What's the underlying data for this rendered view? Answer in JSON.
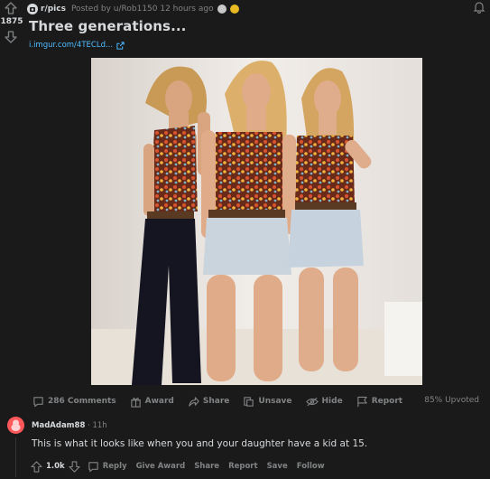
{
  "post": {
    "score": "1875",
    "subreddit": "r/pics",
    "posted_by": "Posted by u/Rob1150 12 hours ago",
    "title": "Three generations...",
    "link_text": "i.imgur.com/4TECLd...",
    "image_alt": "Three women in matching floral halter tops posing together",
    "actions": {
      "comments": "286 Comments",
      "award": "Award",
      "share": "Share",
      "unsave": "Unsave",
      "hide": "Hide",
      "report": "Report"
    },
    "upvoted": "85% Upvoted"
  },
  "comment": {
    "author": "MadAdam88",
    "time": "· 11h",
    "body": "This is what it looks like when you and your daughter have a kid at 15.",
    "score": "1.0k",
    "actions": {
      "reply": "Reply",
      "give_award": "Give Award",
      "share": "Share",
      "report": "Report",
      "save": "Save",
      "follow": "Follow"
    }
  },
  "colors": {
    "background": "#1a1a1b",
    "text": "#d7dadc",
    "muted": "#818384",
    "link": "#4fbcff",
    "avatar": "#ff585b"
  }
}
